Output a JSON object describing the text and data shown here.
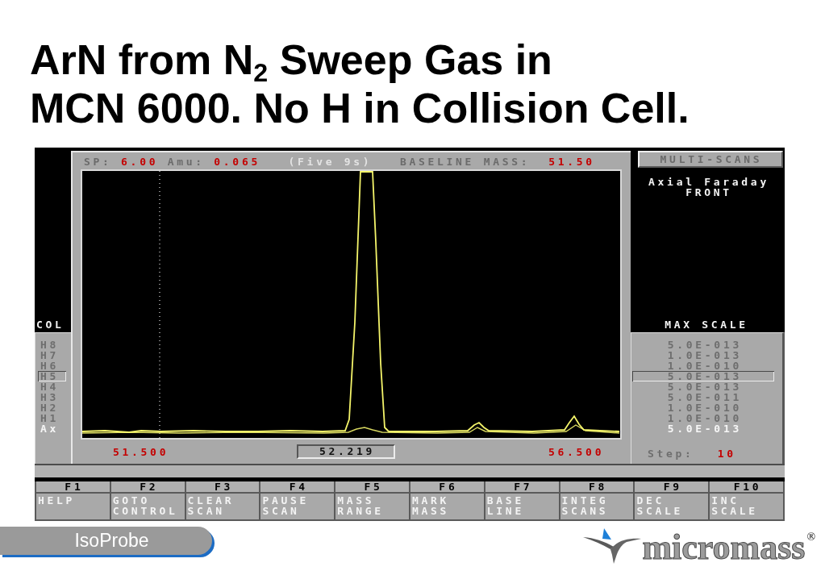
{
  "title": {
    "lines": [
      "ArN from N$_{2}$ Sweep Gas in",
      "MCN 6000. No H in Collision Cell."
    ]
  },
  "instrument_screen": {
    "collector_heading": "COL",
    "header": [
      {
        "kind": "pair",
        "label": "SP:",
        "value": "6.00"
      },
      {
        "kind": "pair",
        "label": "Amu:",
        "value": "0.065"
      },
      {
        "kind": "note",
        "text": "(Five 9s)"
      },
      {
        "kind": "pair",
        "label": "BASELINE MASS:",
        "value": "51.50"
      }
    ],
    "mass_axis": {
      "start": "51.500",
      "cursor": "52.219",
      "end": "56.500"
    },
    "mode_button": "MULTI-SCANS",
    "detector_name": "Axial Faraday",
    "detector_position": "FRONT",
    "scale_heading": "MAX SCALE",
    "collectors": [
      {
        "name": "H8",
        "max_scale": "5.0E-013",
        "selected": false,
        "active": false
      },
      {
        "name": "H7",
        "max_scale": "1.0E-013",
        "selected": false,
        "active": false
      },
      {
        "name": "H6",
        "max_scale": "1.0E-010",
        "selected": false,
        "active": false
      },
      {
        "name": "H5",
        "max_scale": "5.0E-013",
        "selected": true,
        "active": false
      },
      {
        "name": "H4",
        "max_scale": "5.0E-013",
        "selected": false,
        "active": false
      },
      {
        "name": "H3",
        "max_scale": "5.0E-011",
        "selected": false,
        "active": false
      },
      {
        "name": "H2",
        "max_scale": "1.0E-010",
        "selected": false,
        "active": false
      },
      {
        "name": "H1",
        "max_scale": "1.0E-010",
        "selected": false,
        "active": false
      },
      {
        "name": "Ax",
        "max_scale": "5.0E-013",
        "selected": false,
        "active": true
      }
    ],
    "step": {
      "label": "Step:",
      "value": "10"
    },
    "function_keys": [
      {
        "key": "F1",
        "lines": [
          "HELP"
        ]
      },
      {
        "key": "F2",
        "lines": [
          "GOTO",
          "CONTROL"
        ]
      },
      {
        "key": "F3",
        "lines": [
          "CLEAR",
          "SCAN"
        ]
      },
      {
        "key": "F4",
        "lines": [
          "PAUSE",
          "SCAN"
        ]
      },
      {
        "key": "F5",
        "lines": [
          "MASS",
          "RANGE"
        ]
      },
      {
        "key": "F6",
        "lines": [
          "MARK",
          "MASS"
        ]
      },
      {
        "key": "F7",
        "lines": [
          "BASE",
          "LINE"
        ]
      },
      {
        "key": "F8",
        "lines": [
          "INTEG",
          "SCANS"
        ]
      },
      {
        "key": "F9",
        "lines": [
          "DEC",
          "SCALE"
        ]
      },
      {
        "key": "F10",
        "lines": [
          "INC",
          "SCALE"
        ]
      }
    ]
  },
  "footer": {
    "product": "IsoProbe",
    "logo": "micromass$^{®}$"
  }
}
